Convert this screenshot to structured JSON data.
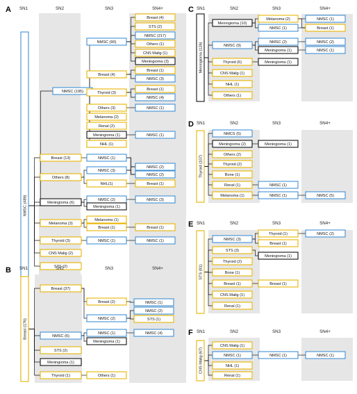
{
  "colors": {
    "blue": "#3f8fd4",
    "yellow": "#e8b400",
    "black": "#111111",
    "panel_bg": "#e6e6e6"
  },
  "panels": [
    {
      "letter": "A",
      "headers": [
        "SN1",
        "SN2",
        "SN3",
        "SN4+"
      ],
      "root": {
        "label": "NMSC (489)",
        "color": "blue"
      },
      "sn2": [
        {
          "label": "NMSC (195)",
          "color": "blue"
        },
        {
          "label": "Breast (13)",
          "color": "yellow"
        },
        {
          "label": "Others (8)",
          "color": "yellow"
        },
        {
          "label": "Meningioma (6)",
          "color": "black"
        },
        {
          "label": "Melanoma (3)",
          "color": "yellow"
        },
        {
          "label": "Thyroid  (3)",
          "color": "yellow"
        },
        {
          "label": "CNS Malig (2)",
          "color": "yellow"
        },
        {
          "label": "STS (2)",
          "color": "yellow"
        }
      ],
      "sn3": [
        {
          "label": "NMSC (90)",
          "color": "blue"
        },
        {
          "label": "Breast (4)",
          "color": "yellow"
        },
        {
          "label": "Thyroid (3)",
          "color": "yellow"
        },
        {
          "label": "Others (3)",
          "color": "yellow"
        },
        {
          "label": "Melanoma (2)",
          "color": "yellow"
        },
        {
          "label": "Renal (2)",
          "color": "yellow"
        },
        {
          "label": "Meningioma (1)",
          "color": "black"
        },
        {
          "label": "NHL (1)",
          "color": "yellow"
        },
        {
          "label": "NMSC  (1)",
          "color": "blue"
        },
        {
          "label": "NMSC (3)",
          "color": "blue"
        },
        {
          "label": "NHL(1)",
          "color": "yellow"
        },
        {
          "label": "NMSC (2)",
          "color": "blue"
        },
        {
          "label": "Meningioma (1)",
          "color": "black"
        },
        {
          "label": "Melanoma (1)",
          "color": "yellow"
        },
        {
          "label": "Breast (1)",
          "color": "yellow"
        },
        {
          "label": "NMSC (1)",
          "color": "blue"
        }
      ],
      "sn4": [
        {
          "label": "Breast (4)",
          "color": "yellow"
        },
        {
          "label": "STS (2)",
          "color": "yellow"
        },
        {
          "label": "NMSC (217)",
          "color": "blue"
        },
        {
          "label": "Others (1)",
          "color": "yellow"
        },
        {
          "label": "CNS Malig (1)",
          "color": "yellow"
        },
        {
          "label": "Meningioma (3)",
          "color": "black"
        },
        {
          "label": "Breast (1)",
          "color": "yellow"
        },
        {
          "label": "NMSC (3)",
          "color": "blue"
        },
        {
          "label": "Breast (1)",
          "color": "yellow"
        },
        {
          "label": "NMSC (4)",
          "color": "blue"
        },
        {
          "label": "NMSC (1)",
          "color": "blue"
        },
        {
          "label": "NMSC (1)",
          "color": "blue"
        },
        {
          "label": "NMSC (2)",
          "color": "blue"
        },
        {
          "label": "NMSC (2)",
          "color": "blue"
        },
        {
          "label": "Breast (1)",
          "color": "yellow"
        },
        {
          "label": "NMSC (3)",
          "color": "blue"
        },
        {
          "label": "Breast (1)",
          "color": "yellow"
        },
        {
          "label": "NMSC (1)",
          "color": "blue"
        }
      ]
    },
    {
      "letter": "B",
      "headers": [
        "SN1",
        "SN2",
        "SN3",
        "SN4+"
      ],
      "root": {
        "label": "Breast (176)",
        "color": "yellow"
      },
      "sn2": [
        {
          "label": "Breast (37)",
          "color": "yellow"
        },
        {
          "label": "NMSC (6)",
          "color": "blue"
        },
        {
          "label": "STS (2)",
          "color": "yellow"
        },
        {
          "label": "Meningioma (1)",
          "color": "black"
        },
        {
          "label": "Thyroid  (1)",
          "color": "yellow"
        }
      ],
      "sn3": [
        {
          "label": "Breast (2)",
          "color": "yellow"
        },
        {
          "label": "NMSC (2)",
          "color": "blue"
        },
        {
          "label": "NMSC (1)",
          "color": "blue"
        },
        {
          "label": "Meningioma (1)",
          "color": "black"
        },
        {
          "label": "Others (1)",
          "color": "yellow"
        }
      ],
      "sn4": [
        {
          "label": "NMSC (1)",
          "color": "blue"
        },
        {
          "label": "NMSC (2)",
          "color": "blue"
        },
        {
          "label": "STS (1)",
          "color": "yellow"
        },
        {
          "label": "NMSC (4)",
          "color": "blue"
        }
      ]
    },
    {
      "letter": "C",
      "headers": [
        "SN1",
        "SN2",
        "SN3",
        "SN4+"
      ],
      "root": {
        "label": "Meningioma (126)",
        "color": "black"
      },
      "sn2": [
        {
          "label": "Meningioma (10)",
          "color": "black"
        },
        {
          "label": "NMSC (9)",
          "color": "blue"
        },
        {
          "label": "Thyroid (6)",
          "color": "yellow"
        },
        {
          "label": "CNS Malig (1)",
          "color": "yellow"
        },
        {
          "label": "NHL (1)",
          "color": "yellow"
        },
        {
          "label": "Others (1)",
          "color": "yellow"
        }
      ],
      "sn3": [
        {
          "label": "Melanoma (2)",
          "color": "yellow"
        },
        {
          "label": "NMSC (1)",
          "color": "blue"
        },
        {
          "label": "NMSC (2)",
          "color": "blue"
        },
        {
          "label": "Meningioma (1)",
          "color": "black"
        },
        {
          "label": "Meningioma (1)",
          "color": "black"
        }
      ],
      "sn4": [
        {
          "label": "NMSC (1)",
          "color": "blue"
        },
        {
          "label": "Breast (1)",
          "color": "yellow"
        },
        {
          "label": "NMSC (2)",
          "color": "blue"
        },
        {
          "label": "NMSC (1)",
          "color": "blue"
        }
      ]
    },
    {
      "letter": "D",
      "headers": [
        "SN1",
        "SN2",
        "SN3",
        "SN4+"
      ],
      "root": {
        "label": "Thyroid (107)",
        "color": "yellow"
      },
      "sn2": [
        {
          "label": "NMCS (5)",
          "color": "blue"
        },
        {
          "label": "Meningioma (2)",
          "color": "black"
        },
        {
          "label": "Others (2)",
          "color": "yellow"
        },
        {
          "label": "Thyroid (2)",
          "color": "yellow"
        },
        {
          "label": "Bone (1)",
          "color": "yellow"
        },
        {
          "label": "Renal (1)",
          "color": "yellow"
        },
        {
          "label": "Melanoma  (1)",
          "color": "yellow"
        }
      ],
      "sn3": [
        {
          "label": "Meningioma (1)",
          "color": "black"
        },
        {
          "label": "NMSC (1)",
          "color": "blue"
        },
        {
          "label": "NMSC (1)",
          "color": "blue"
        }
      ],
      "sn4": [
        {
          "label": "NMSC (5)",
          "color": "blue"
        }
      ]
    },
    {
      "letter": "E",
      "headers": [
        "SN1",
        "SN2",
        "SN3",
        "SN4+"
      ],
      "root": {
        "label": "STS (81)",
        "color": "yellow"
      },
      "sn2": [
        {
          "label": "NMSC (3)",
          "color": "blue"
        },
        {
          "label": "STS (3)",
          "color": "yellow"
        },
        {
          "label": "Thyroid (2)",
          "color": "yellow"
        },
        {
          "label": "Bone (1)",
          "color": "yellow"
        },
        {
          "label": "Breast (1)",
          "color": "yellow"
        },
        {
          "label": "CNS Malig (1)",
          "color": "yellow"
        },
        {
          "label": "Renal (1)",
          "color": "yellow"
        }
      ],
      "sn3": [
        {
          "label": "Thyroid (1)",
          "color": "yellow"
        },
        {
          "label": "Breast (1)",
          "color": "yellow"
        },
        {
          "label": "Meningioma (1)",
          "color": "black"
        },
        {
          "label": "Breast (1)",
          "color": "yellow"
        }
      ],
      "sn4": [
        {
          "label": "NMSC (2)",
          "color": "blue"
        }
      ]
    },
    {
      "letter": "F",
      "headers": [
        "SN1",
        "SN2",
        "SN3",
        "SN4+"
      ],
      "root": {
        "label": "CNS Malig (67)",
        "color": "yellow"
      },
      "sn2": [
        {
          "label": "CNS Malig (1)",
          "color": "yellow"
        },
        {
          "label": "NMSC (1)",
          "color": "blue"
        },
        {
          "label": "NHL (1)",
          "color": "yellow"
        },
        {
          "label": "Renal (1)",
          "color": "yellow"
        }
      ],
      "sn3": [
        {
          "label": "NMSC (1)",
          "color": "blue"
        }
      ],
      "sn4": [
        {
          "label": "NMSC (1)",
          "color": "blue"
        }
      ]
    }
  ]
}
